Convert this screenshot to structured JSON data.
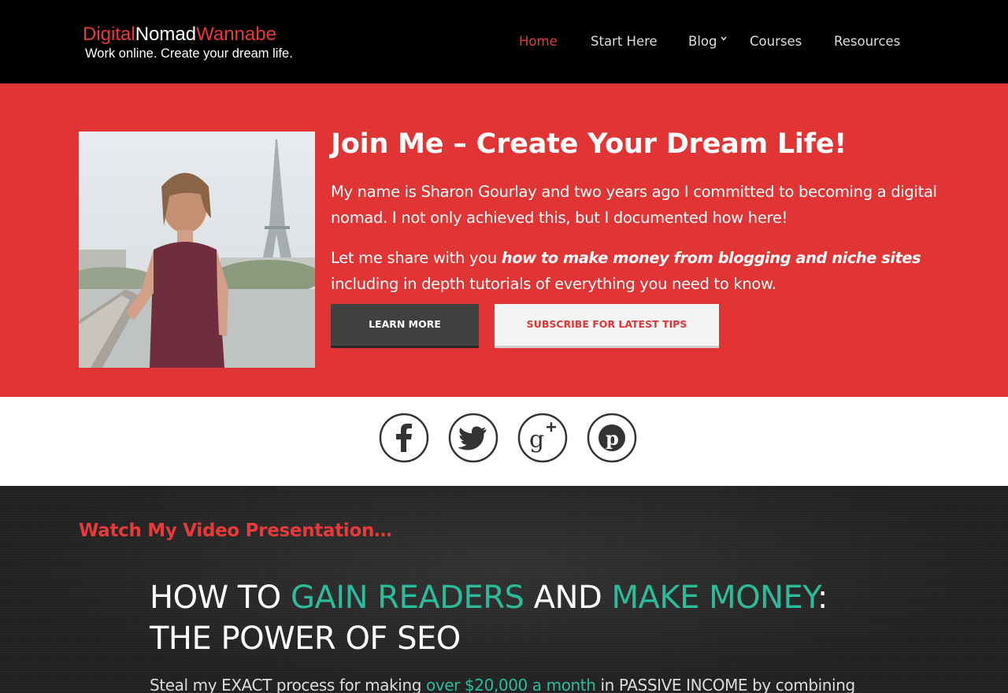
{
  "logo": {
    "part1": "Digital",
    "part2": "Nomad",
    "part3": "Wannabe",
    "tagline": "Work online. Create your dream life."
  },
  "nav": {
    "items": [
      {
        "label": "Home",
        "active": true
      },
      {
        "label": "Start Here"
      },
      {
        "label": "Blog",
        "has_dropdown": true
      },
      {
        "label": "Courses"
      },
      {
        "label": "Resources"
      }
    ]
  },
  "hero": {
    "title": "Join Me – Create Your Dream Life!",
    "p1": "My name is Sharon Gourlay and two years ago I committed to becoming a digital nomad. I not only achieved this, but I documented how here!",
    "p2_before": "Let me share with you ",
    "p2_bold": "how to make money from blogging and niche sites",
    "p2_after": " including in depth tutorials of everything you need to know.",
    "learn_more": "LEARN MORE",
    "subscribe": "SUBSCRIBE FOR LATEST TIPS"
  },
  "social": {
    "icons": [
      "facebook-icon",
      "twitter-icon",
      "google-plus-icon",
      "pinterest-icon"
    ]
  },
  "video": {
    "heading": "Watch My Video Presentation…",
    "line1_a": "HOW TO ",
    "line1_b": "GAIN READERS",
    "line1_c": " AND ",
    "line1_d": "MAKE MONEY",
    "line1_e": ":",
    "line2": "THE POWER OF SEO",
    "steal_a": "Steal my EXACT process for making ",
    "steal_b": "over $20,000 a month",
    "steal_c": " in PASSIVE INCOME by combining"
  },
  "colors": {
    "brand_red": "#e13435",
    "accent_teal": "#2bbc9b",
    "header_bg": "#000000"
  }
}
